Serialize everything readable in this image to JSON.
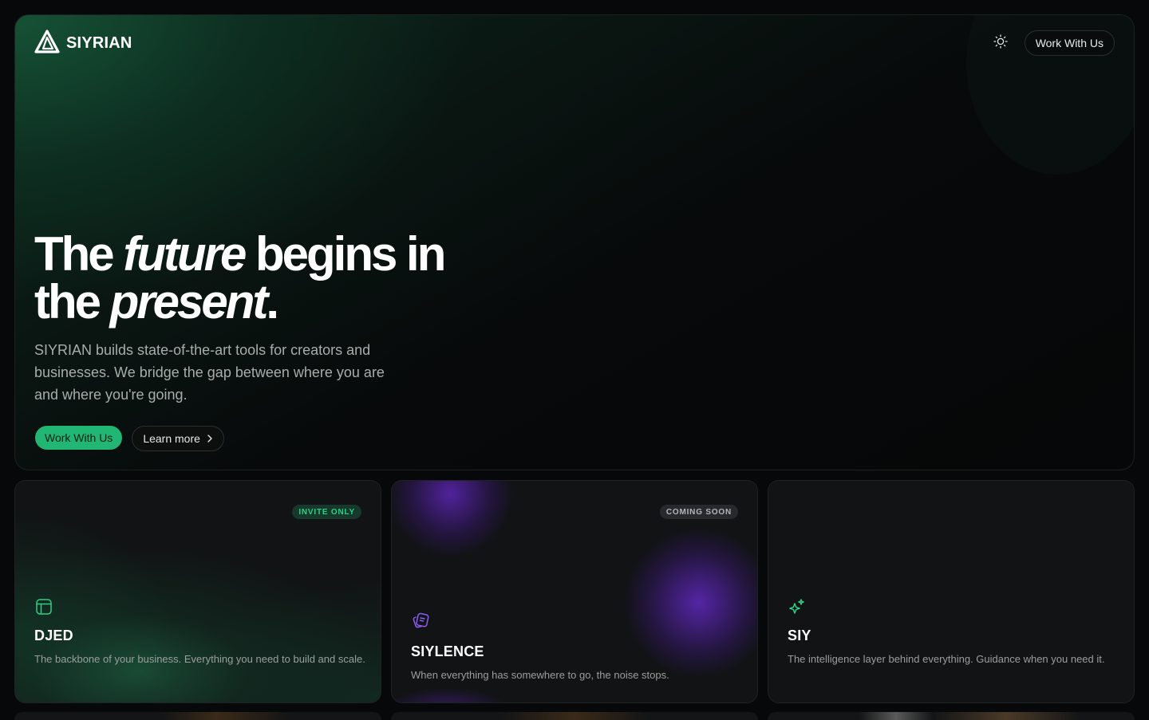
{
  "brand": {
    "name": "SIYRIAN",
    "logo_icon": "triangle-logo-icon"
  },
  "nav": {
    "theme_toggle_icon": "sun-icon",
    "cta_label": "Work With Us"
  },
  "hero": {
    "headline": {
      "part1": "The ",
      "emph1": "future",
      "part2": " begins in the ",
      "emph2": "present",
      "part3": "."
    },
    "subtitle": "SIYRIAN builds state-of-the-art tools for creators and businesses. We bridge the gap between where you are and where you're going.",
    "primary_cta": "Work With Us",
    "secondary_cta": "Learn more"
  },
  "products": [
    {
      "name": "DJED",
      "badge": "INVITE ONLY",
      "description": "The backbone of your business. Everything you need to build and scale.",
      "icon": "layout-icon"
    },
    {
      "name": "SIYLENCE",
      "badge": "COMING SOON",
      "description": "When everything has somewhere to go, the noise stops.",
      "icon": "cards-icon"
    },
    {
      "name": "SIY",
      "badge": "",
      "description": "The intelligence layer behind everything. Guidance when you need it.",
      "icon": "sparkle-icon"
    }
  ],
  "colors": {
    "accent": "#21b673",
    "purple": "#6a2cc8",
    "background": "#070809"
  }
}
